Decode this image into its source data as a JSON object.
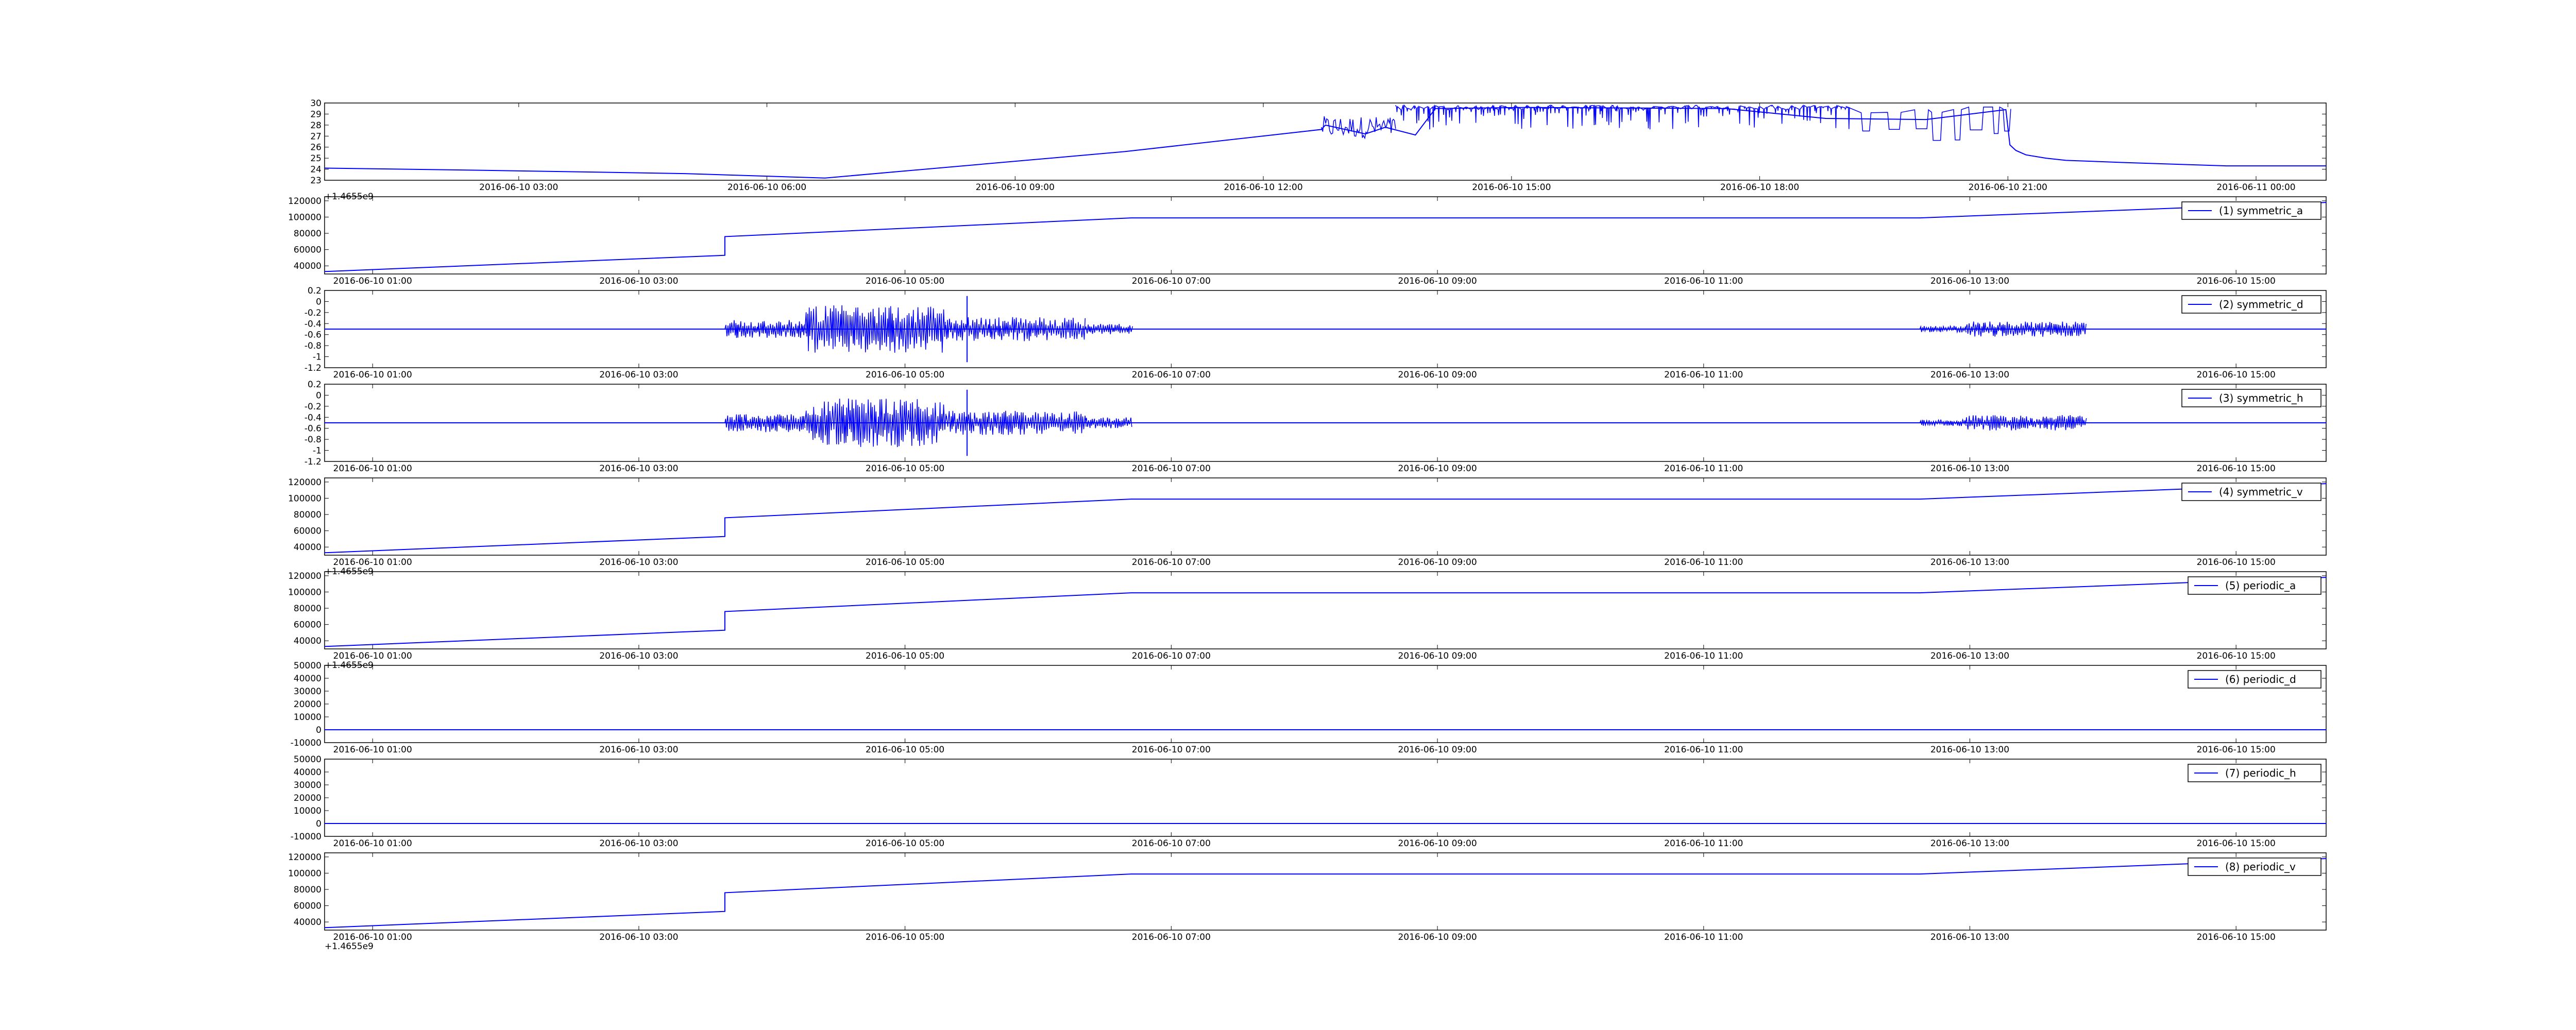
{
  "figure": {
    "background": "#ffffff"
  },
  "colors": {
    "series_line": "#0000ff",
    "axes": "#000000"
  },
  "chart_data": [
    {
      "type": "line",
      "legend": null,
      "offset_label": "+1.4655e9",
      "ylim": [
        23,
        30
      ],
      "y_ticks": [
        23,
        24,
        25,
        26,
        27,
        28,
        29,
        30
      ],
      "x_ticks": [
        "2016-06-10 03:00",
        "2016-06-10 06:00",
        "2016-06-10 09:00",
        "2016-06-10 12:00",
        "2016-06-10 15:00",
        "2016-06-10 18:00",
        "2016-06-10 21:00",
        "2016-06-11 00:00"
      ],
      "x_tick_fracs": [
        0.097,
        0.221,
        0.345,
        0.469,
        0.593,
        0.717,
        0.841,
        0.965
      ],
      "grid": false,
      "series": [
        {
          "x_frac": [
            0,
            0.08,
            0.18,
            0.25,
            0.4,
            0.498,
            0.5,
            0.52,
            0.53,
            0.545,
            0.555,
            0.6,
            0.7,
            0.75,
            0.8,
            0.84,
            0.842,
            0.845,
            0.85,
            0.86,
            0.87,
            0.9,
            0.95,
            1.0
          ],
          "y": [
            24.1,
            23.9,
            23.6,
            23.2,
            25.6,
            27.6,
            28.0,
            27.2,
            27.8,
            27.1,
            29.5,
            29.6,
            29.5,
            28.6,
            28.5,
            29.4,
            26.2,
            25.7,
            25.3,
            25.0,
            24.8,
            24.6,
            24.3,
            24.3
          ],
          "noise": [
            {
              "from": 0.498,
              "to": 0.535,
              "low": 26.8,
              "high": 28.8,
              "style": "dense"
            },
            {
              "from": 0.535,
              "to": 0.76,
              "low": 27.6,
              "high": 29.8,
              "style": "spikes_down"
            },
            {
              "from": 0.76,
              "to": 0.842,
              "low": 26.6,
              "high": 29.7,
              "style": "blocks"
            }
          ]
        }
      ]
    },
    {
      "type": "line",
      "legend": "(1) symmetric_a",
      "offset_label": "",
      "ylim": [
        30000,
        125000
      ],
      "y_ticks": [
        40000,
        60000,
        80000,
        100000,
        120000
      ],
      "x_ticks": [
        "2016-06-10 01:00",
        "2016-06-10 03:00",
        "2016-06-10 05:00",
        "2016-06-10 07:00",
        "2016-06-10 09:00",
        "2016-06-10 11:00",
        "2016-06-10 13:00",
        "2016-06-10 15:00"
      ],
      "x_tick_fracs": [
        0.024,
        0.157,
        0.29,
        0.423,
        0.556,
        0.689,
        0.822,
        0.955
      ],
      "grid": false,
      "series": [
        {
          "x_frac": [
            0,
            0.2,
            0.2,
            0.403,
            0.797,
            1.0
          ],
          "y": [
            33000,
            53000,
            76000,
            99000,
            99000,
            118000
          ]
        }
      ]
    },
    {
      "type": "line",
      "legend": "(2) symmetric_d",
      "offset_label": "",
      "ylim": [
        -1.2,
        0.2
      ],
      "y_ticks": [
        -1.2,
        -1.0,
        -0.8,
        -0.6,
        -0.4,
        -0.2,
        0.0,
        0.2
      ],
      "x_ticks": [
        "2016-06-10 01:00",
        "2016-06-10 03:00",
        "2016-06-10 05:00",
        "2016-06-10 07:00",
        "2016-06-10 09:00",
        "2016-06-10 11:00",
        "2016-06-10 13:00",
        "2016-06-10 15:00"
      ],
      "x_tick_fracs": [
        0.024,
        0.157,
        0.29,
        0.423,
        0.556,
        0.689,
        0.822,
        0.955
      ],
      "grid": false,
      "series": [
        {
          "x_frac": [
            0,
            1.0
          ],
          "y": [
            -0.5,
            -0.5
          ],
          "noise": [
            {
              "from": 0.2,
              "to": 0.24,
              "amp": 0.17
            },
            {
              "from": 0.24,
              "to": 0.31,
              "amp": 0.44
            },
            {
              "from": 0.31,
              "to": 0.38,
              "amp": 0.22
            },
            {
              "from": 0.38,
              "to": 0.403,
              "amp": 0.1
            },
            {
              "from": 0.797,
              "to": 0.82,
              "amp": 0.06
            },
            {
              "from": 0.82,
              "to": 0.88,
              "amp": 0.14
            }
          ],
          "spikes": [
            {
              "x_frac": 0.321,
              "low": -1.1,
              "high": 0.1
            }
          ]
        }
      ]
    },
    {
      "type": "line",
      "legend": "(3) symmetric_h",
      "offset_label": "",
      "ylim": [
        -1.2,
        0.2
      ],
      "y_ticks": [
        -1.2,
        -1.0,
        -0.8,
        -0.6,
        -0.4,
        -0.2,
        0.0,
        0.2
      ],
      "x_ticks": [
        "2016-06-10 01:00",
        "2016-06-10 03:00",
        "2016-06-10 05:00",
        "2016-06-10 07:00",
        "2016-06-10 09:00",
        "2016-06-10 11:00",
        "2016-06-10 13:00",
        "2016-06-10 15:00"
      ],
      "x_tick_fracs": [
        0.024,
        0.157,
        0.29,
        0.423,
        0.556,
        0.689,
        0.822,
        0.955
      ],
      "grid": false,
      "series": [
        {
          "x_frac": [
            0,
            1.0
          ],
          "y": [
            -0.5,
            -0.5
          ],
          "noise": [
            {
              "from": 0.2,
              "to": 0.24,
              "amp": 0.17
            },
            {
              "from": 0.24,
              "to": 0.31,
              "amp": 0.44
            },
            {
              "from": 0.31,
              "to": 0.38,
              "amp": 0.22
            },
            {
              "from": 0.38,
              "to": 0.403,
              "amp": 0.1
            },
            {
              "from": 0.797,
              "to": 0.82,
              "amp": 0.06
            },
            {
              "from": 0.82,
              "to": 0.88,
              "amp": 0.14
            }
          ],
          "spikes": [
            {
              "x_frac": 0.321,
              "low": -1.1,
              "high": 0.1
            }
          ]
        }
      ]
    },
    {
      "type": "line",
      "legend": "(4) symmetric_v",
      "offset_label": "+1.4655e9",
      "ylim": [
        30000,
        125000
      ],
      "y_ticks": [
        40000,
        60000,
        80000,
        100000,
        120000
      ],
      "x_ticks": [
        "2016-06-10 01:00",
        "2016-06-10 03:00",
        "2016-06-10 05:00",
        "2016-06-10 07:00",
        "2016-06-10 09:00",
        "2016-06-10 11:00",
        "2016-06-10 13:00",
        "2016-06-10 15:00"
      ],
      "x_tick_fracs": [
        0.024,
        0.157,
        0.29,
        0.423,
        0.556,
        0.689,
        0.822,
        0.955
      ],
      "grid": false,
      "series": [
        {
          "x_frac": [
            0,
            0.2,
            0.2,
            0.403,
            0.797,
            1.0
          ],
          "y": [
            33000,
            53000,
            76000,
            99000,
            99000,
            118000
          ]
        }
      ]
    },
    {
      "type": "line",
      "legend": "(5) periodic_a",
      "offset_label": "+1.4655e9",
      "ylim": [
        30000,
        125000
      ],
      "y_ticks": [
        40000,
        60000,
        80000,
        100000,
        120000
      ],
      "x_ticks": [
        "2016-06-10 01:00",
        "2016-06-10 03:00",
        "2016-06-10 05:00",
        "2016-06-10 07:00",
        "2016-06-10 09:00",
        "2016-06-10 11:00",
        "2016-06-10 13:00",
        "2016-06-10 15:00"
      ],
      "x_tick_fracs": [
        0.024,
        0.157,
        0.29,
        0.423,
        0.556,
        0.689,
        0.822,
        0.955
      ],
      "grid": false,
      "series": [
        {
          "x_frac": [
            0,
            0.2,
            0.2,
            0.403,
            0.797,
            1.0
          ],
          "y": [
            33000,
            53000,
            76000,
            99000,
            99000,
            118000
          ]
        }
      ]
    },
    {
      "type": "line",
      "legend": "(6) periodic_d",
      "offset_label": "",
      "ylim": [
        -10000,
        50000
      ],
      "y_ticks": [
        -10000,
        0,
        10000,
        20000,
        30000,
        40000,
        50000
      ],
      "x_ticks": [
        "2016-06-10 01:00",
        "2016-06-10 03:00",
        "2016-06-10 05:00",
        "2016-06-10 07:00",
        "2016-06-10 09:00",
        "2016-06-10 11:00",
        "2016-06-10 13:00",
        "2016-06-10 15:00"
      ],
      "x_tick_fracs": [
        0.024,
        0.157,
        0.29,
        0.423,
        0.556,
        0.689,
        0.822,
        0.955
      ],
      "grid": false,
      "series": [
        {
          "x_frac": [
            0,
            1.0
          ],
          "y": [
            0,
            0
          ]
        }
      ]
    },
    {
      "type": "line",
      "legend": "(7) periodic_h",
      "offset_label": "",
      "ylim": [
        -10000,
        50000
      ],
      "y_ticks": [
        -10000,
        0,
        10000,
        20000,
        30000,
        40000,
        50000
      ],
      "x_ticks": [
        "2016-06-10 01:00",
        "2016-06-10 03:00",
        "2016-06-10 05:00",
        "2016-06-10 07:00",
        "2016-06-10 09:00",
        "2016-06-10 11:00",
        "2016-06-10 13:00",
        "2016-06-10 15:00"
      ],
      "x_tick_fracs": [
        0.024,
        0.157,
        0.29,
        0.423,
        0.556,
        0.689,
        0.822,
        0.955
      ],
      "grid": false,
      "series": [
        {
          "x_frac": [
            0,
            1.0
          ],
          "y": [
            0,
            0
          ]
        }
      ]
    },
    {
      "type": "line",
      "legend": "(8) periodic_v",
      "offset_label": "+1.4655e9",
      "ylim": [
        30000,
        125000
      ],
      "y_ticks": [
        40000,
        60000,
        80000,
        100000,
        120000
      ],
      "x_ticks": [
        "2016-06-10 01:00",
        "2016-06-10 03:00",
        "2016-06-10 05:00",
        "2016-06-10 07:00",
        "2016-06-10 09:00",
        "2016-06-10 11:00",
        "2016-06-10 13:00",
        "2016-06-10 15:00"
      ],
      "x_tick_fracs": [
        0.024,
        0.157,
        0.29,
        0.423,
        0.556,
        0.689,
        0.822,
        0.955
      ],
      "grid": false,
      "series": [
        {
          "x_frac": [
            0,
            0.2,
            0.2,
            0.403,
            0.797,
            1.0
          ],
          "y": [
            33000,
            53000,
            76000,
            99000,
            99000,
            118000
          ]
        }
      ]
    }
  ]
}
